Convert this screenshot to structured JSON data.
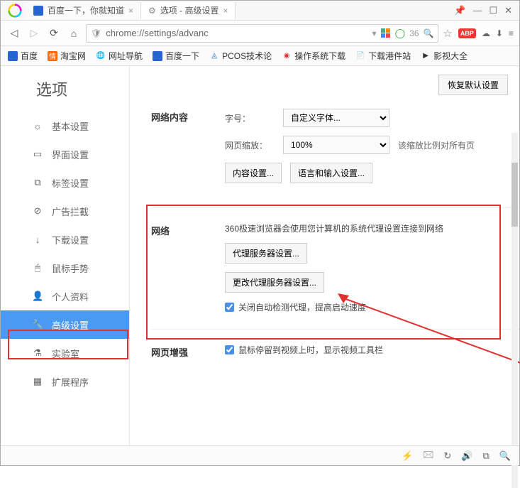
{
  "window": {
    "pin_icon": "📌",
    "min": "—",
    "max": "☐",
    "close": "✕"
  },
  "tabs": [
    {
      "title": "百度一下，你就知道",
      "icon": "paw"
    },
    {
      "title": "选项 - 高级设置",
      "icon": "gear",
      "active": true
    }
  ],
  "nav": {
    "url": "chrome://settings/advanc",
    "shield": "🛡",
    "search_num": "36",
    "star": "☆"
  },
  "bookmarks": [
    {
      "label": "百度",
      "icon": "paw"
    },
    {
      "label": "淘宝网",
      "icon": "tb"
    },
    {
      "label": "网址导航",
      "icon": "globe"
    },
    {
      "label": "百度一下",
      "icon": "paw"
    },
    {
      "label": "PCOS技术论",
      "icon": "pcos"
    },
    {
      "label": "操作系统下载",
      "icon": "os"
    },
    {
      "label": "下载港件站",
      "icon": "dl"
    },
    {
      "label": "影视大全",
      "icon": "movie"
    }
  ],
  "sidebar": {
    "title": "选项",
    "items": [
      {
        "label": "基本设置",
        "icon": "☼"
      },
      {
        "label": "界面设置",
        "icon": "▭"
      },
      {
        "label": "标签设置",
        "icon": "⧉"
      },
      {
        "label": "广告拦截",
        "icon": "⊘"
      },
      {
        "label": "下载设置",
        "icon": "↓"
      },
      {
        "label": "鼠标手势",
        "icon": "🖱"
      },
      {
        "label": "个人资料",
        "icon": "👤"
      },
      {
        "label": "高级设置",
        "icon": "🔧",
        "active": true
      },
      {
        "label": "实验室",
        "icon": "⚗"
      },
      {
        "label": "扩展程序",
        "icon": "▦"
      }
    ]
  },
  "main": {
    "restore_default": "恢复默认设置",
    "web_content": {
      "title": "网络内容",
      "font_label": "字号：",
      "font_value": "自定义字体...",
      "zoom_label": "网页缩放：",
      "zoom_value": "100%",
      "zoom_hint": "该缩放比例对所有页",
      "content_settings": "内容设置...",
      "lang_settings": "语言和输入设置..."
    },
    "network": {
      "title": "网络",
      "desc": "360极速浏览器会使用您计算机的系统代理设置连接到网络",
      "proxy_btn": "代理服务器设置...",
      "change_proxy_btn": "更改代理服务器设置...",
      "checkbox_label": "关闭自动检测代理，提高启动速度"
    },
    "enhance": {
      "title": "网页增强",
      "checkbox_label": "鼠标停留到视频上时，显示视频工具栏"
    }
  }
}
